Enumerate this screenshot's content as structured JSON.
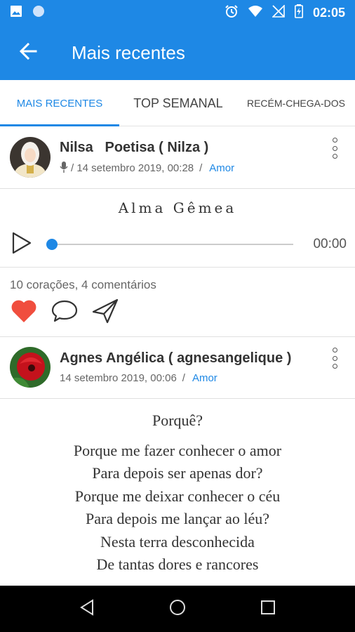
{
  "status_bar": {
    "time": "02:05"
  },
  "app_bar": {
    "title": "Mais recentes"
  },
  "tabs": [
    {
      "label": "MAIS RECENTES",
      "active": true
    },
    {
      "label": "TOP SEMANAL",
      "active": false
    },
    {
      "label": "RECÉM-CHEGA-DOS",
      "active": false
    }
  ],
  "posts": [
    {
      "author": "Nilsa   Poetisa ( Nilza )",
      "date": "/ 14 setembro 2019, 00:28",
      "separator": "/",
      "category": "Amor",
      "poem_title": "Alma Gêmea",
      "audio_time": "00:00",
      "stats": "10 corações, 4 comentários"
    },
    {
      "author": "Agnes Angélica ( agnesangelique )",
      "date": "14 setembro 2019, 00:06",
      "separator": "/",
      "category": "Amor",
      "poem_title": "Porquê?",
      "poem_lines": [
        "Porque me fazer conhecer o amor",
        "Para depois ser apenas dor?",
        "Porque me deixar conhecer o céu",
        "Para depois me lançar ao léu?",
        "Nesta terra desconhecida",
        "De tantas dores e rancores"
      ]
    }
  ],
  "colors": {
    "primary": "#1e88e5",
    "heart": "#f04e3e",
    "nav_bar": "#000000"
  }
}
